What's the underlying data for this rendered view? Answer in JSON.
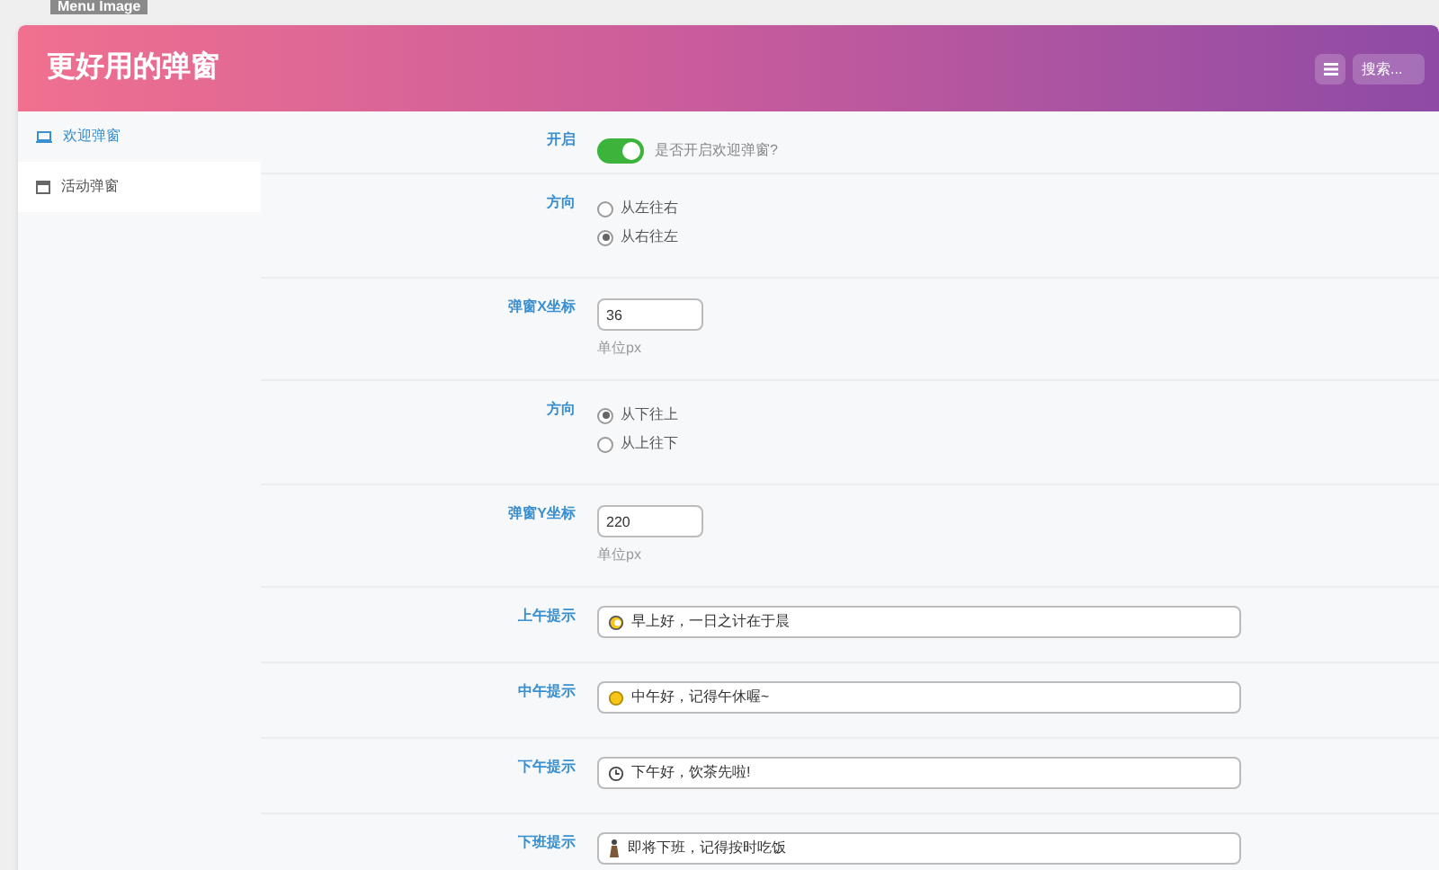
{
  "tag": "Menu Image",
  "header": {
    "title": "更好用的弹窗",
    "search_placeholder": "搜索..."
  },
  "sidebar": {
    "items": [
      {
        "label": "欢迎弹窗",
        "selected": true
      },
      {
        "label": "活动弹窗",
        "selected": false
      }
    ]
  },
  "form": [
    {
      "kind": "switch",
      "label": "开启",
      "on": true,
      "hint": "是否开启欢迎弹窗?"
    },
    {
      "kind": "radio",
      "label": "方向",
      "options": [
        {
          "label": "从左往右",
          "selected": false
        },
        {
          "label": "从右往左",
          "selected": true
        }
      ]
    },
    {
      "kind": "number",
      "label": "弹窗X坐标",
      "value": "36",
      "hint": "单位px"
    },
    {
      "kind": "radio",
      "label": "方向",
      "options": [
        {
          "label": "从下往上",
          "selected": true
        },
        {
          "label": "从上往下",
          "selected": false
        }
      ]
    },
    {
      "kind": "number",
      "label": "弹窗Y坐标",
      "value": "220",
      "hint": "单位px"
    },
    {
      "kind": "text",
      "label": "上午提示",
      "value": "早上好，一日之计在于晨"
    },
    {
      "kind": "text",
      "label": "中午提示",
      "value": "中午好，记得午休喔~"
    },
    {
      "kind": "text",
      "label": "下午提示",
      "value": "下午好，饮茶先啦!"
    },
    {
      "kind": "text",
      "label": "下班提示",
      "value": "即将下班，记得按时吃饭"
    }
  ]
}
